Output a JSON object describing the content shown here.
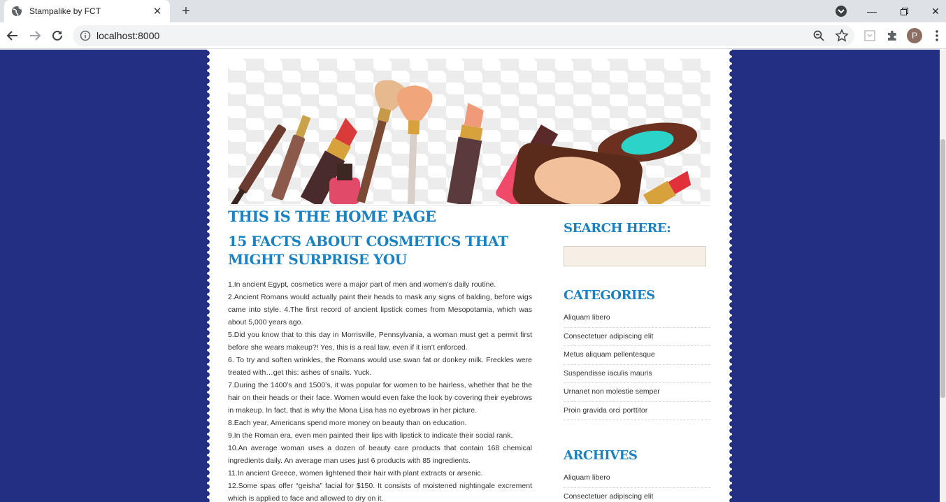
{
  "browser": {
    "tab_title": "Stampalike by FCT",
    "url": "localhost:8000",
    "profile_initial": "P"
  },
  "page": {
    "home_title": "THIS IS THE HOME PAGE",
    "post_title": "15 FACTS ABOUT COSMETICS THAT MIGHT SURPRISE YOU",
    "post_paragraphs": [
      "1.In ancient Egypt, cosmetics were a major part of men and women’s daily routine.",
      "2.Ancient Romans would actually paint their heads to mask any signs of balding, before wigs came into style. 4.The first record of ancient lipstick comes from Mesopotamia, which was about 5,000 years ago.",
      "5.Did you know that to this day in Morrisville, Pennsylvania, a woman must get a permit first before she wears makeup?! Yes, this is a real law, even if it isn’t enforced.",
      "6. To try and soften wrinkles, the Romans would use swan fat or donkey milk. Freckles were treated with…get this: ashes of snails. Yuck.",
      "7.During the 1400’s and 1500’s, it was popular for women to be hairless, whether that be the hair on their heads or their face. Women would even fake the look by covering their eyebrows in makeup. In fact, that is why the Mona Lisa has no eyebrows in her picture.",
      "8.Each year, Americans spend more money on beauty than on education.",
      "9.In the Roman era, even men painted their lips with lipstick to indicate their social rank.",
      "10.An average woman uses a dozen of beauty care products that contain 168 chemical ingredients daily. An average man uses just 6 products with 85 ingredients.",
      "11.In ancient Greece, women lightened their hair with plant extracts or arsenic.",
      "12.Some spas offer “geisha” facial for $150. It consists of moistened nightingale excrement which is applied to face and allowed to dry on it."
    ],
    "sidebar": {
      "search_heading": "SEARCH HERE:",
      "search_value": "",
      "categories_heading": "CATEGORIES",
      "categories": [
        "Aliquam libero",
        "Consectetuer adipiscing elit",
        "Metus aliquam pellentesque",
        "Suspendisse iaculis mauris",
        "Urnanet non molestie semper",
        "Proin gravida orci porttitor"
      ],
      "archives_heading": "ARCHIVES",
      "archives": [
        "Aliquam libero",
        "Consectetuer adipiscing elit"
      ]
    }
  },
  "colors": {
    "background": "#232f82",
    "heading": "#1a82c3",
    "search_box": "#f5efe6"
  },
  "icons": [
    "globe-icon",
    "close-icon",
    "plus-icon",
    "tab-search-icon",
    "minimize-icon",
    "maximize-icon",
    "window-close-icon",
    "back-icon",
    "forward-icon",
    "reload-icon",
    "info-icon",
    "zoom-icon",
    "star-icon",
    "extension-icon",
    "puzzle-icon",
    "more-icon"
  ]
}
